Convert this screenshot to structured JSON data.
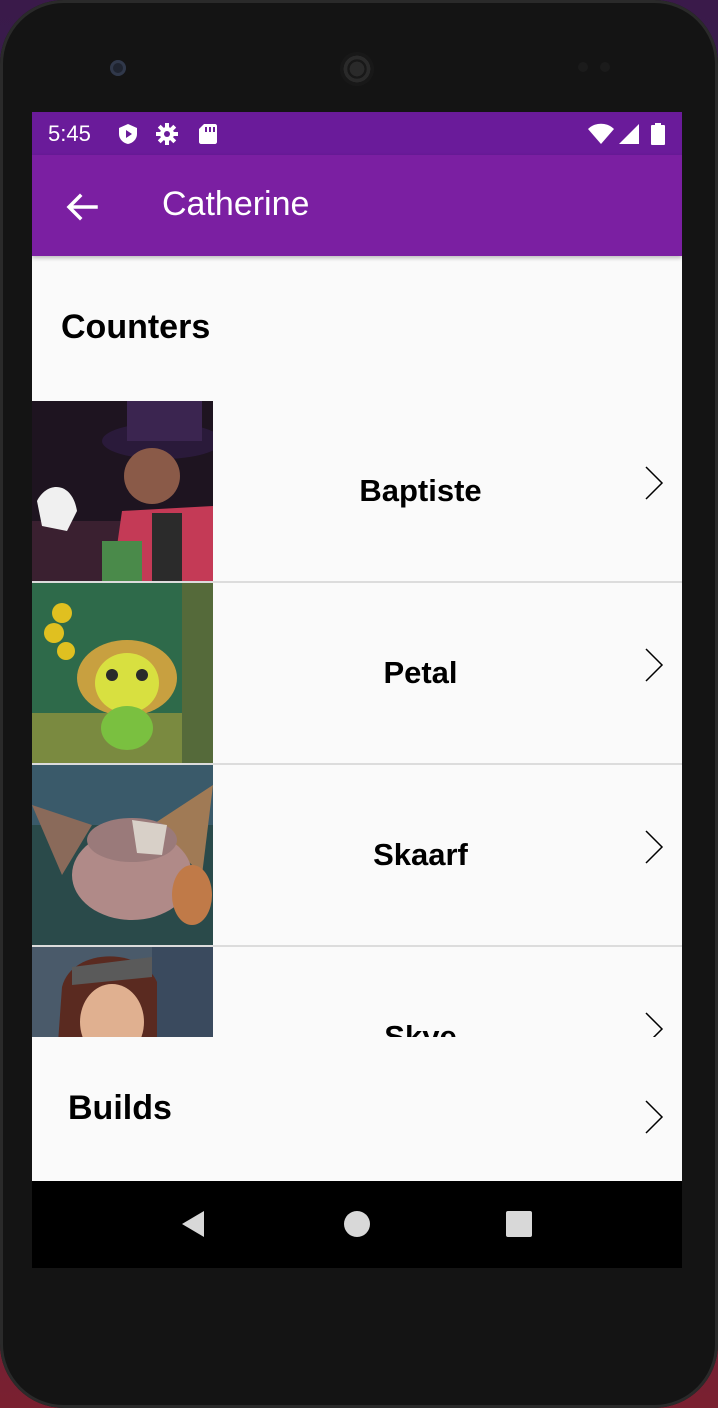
{
  "status_bar": {
    "time": "5:45",
    "icons": [
      "shield-play-icon",
      "gear-icon",
      "sd-card-icon",
      "wifi-icon",
      "signal-icon",
      "battery-icon"
    ]
  },
  "app_bar": {
    "title": "Catherine",
    "back_icon": "arrow-left-icon"
  },
  "counters": {
    "title": "Counters",
    "items": [
      {
        "name": "Baptiste"
      },
      {
        "name": "Petal"
      },
      {
        "name": "Skaarf"
      },
      {
        "name": "Skye"
      }
    ]
  },
  "builds": {
    "label": "Builds"
  },
  "nav_bar": {
    "icons": [
      "back-triangle-icon",
      "home-circle-icon",
      "recents-square-icon"
    ]
  },
  "colors": {
    "status_bar": "#6a1b9a",
    "app_bar": "#7b1fa2",
    "background": "#fafafa"
  }
}
